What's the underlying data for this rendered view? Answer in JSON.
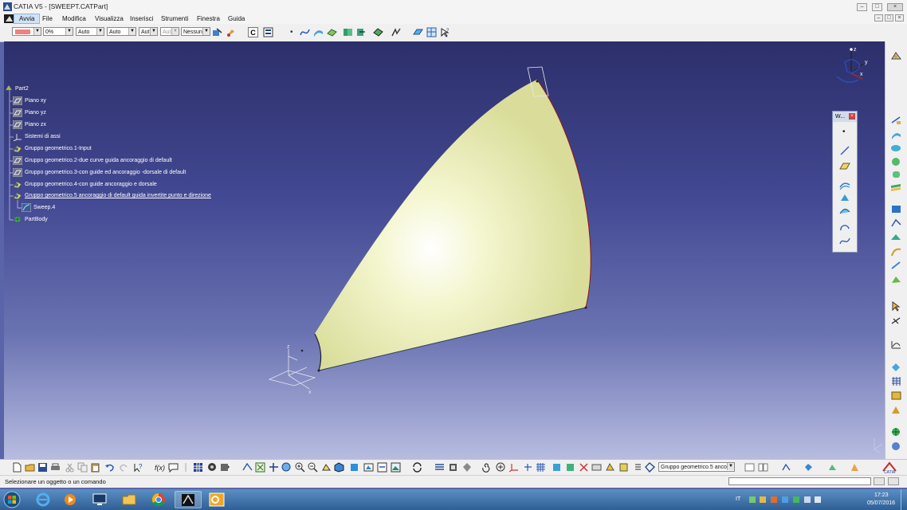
{
  "window": {
    "title": "CATIA V5 - [SWEEPT.CATPart]",
    "controls": [
      "minimize-icon",
      "restore-icon",
      "close-icon"
    ],
    "doc_controls": [
      "minimize-icon",
      "restore-icon",
      "close-icon"
    ]
  },
  "menu": {
    "items": [
      "Avvia",
      "File",
      "Modifica",
      "Visualizza",
      "Inserisci",
      "Strumenti",
      "Finestra",
      "Guida"
    ],
    "active": "Avvia"
  },
  "properties_toolbar": {
    "color": "#f08080",
    "transparency": "0%",
    "line_thickness": "Auto",
    "line_type": "Auto",
    "point_symbol": "Aut",
    "rendering_style": "Aut",
    "layer": "Nessun",
    "c_button": "C"
  },
  "tree": {
    "items": [
      {
        "label": "Part2",
        "icon": "part-icon",
        "level": 0
      },
      {
        "label": "Piano xy",
        "icon": "plane-icon",
        "level": 1
      },
      {
        "label": "Piano yz",
        "icon": "plane-icon",
        "level": 1
      },
      {
        "label": "Piano zx",
        "icon": "plane-icon",
        "level": 1
      },
      {
        "label": "Sistemi di assi",
        "icon": "axis-system-icon",
        "level": 1
      },
      {
        "label": "Gruppo geometrico.1-Input",
        "icon": "geometrical-set-icon",
        "level": 1
      },
      {
        "label": "Gruppo geometrico.2-due curve guida  ancoraggio di default",
        "icon": "geometrical-set-icon",
        "level": 1
      },
      {
        "label": "Gruppo geometrico.3-con guide ed ancoraggio -dorsale di default",
        "icon": "geometrical-set-icon",
        "level": 1
      },
      {
        "label": "Gruppo geometrico.4-con guide ancoraggio e dorsale",
        "icon": "geometrical-set-icon",
        "level": 1
      },
      {
        "label": "Gruppo geometrico.5  ancoraggio di default guida invertite punto e direzione",
        "icon": "geometrical-set-icon",
        "level": 1,
        "selected": true
      },
      {
        "label": "Sweep.4",
        "icon": "sweep-icon",
        "level": 2
      },
      {
        "label": "PartBody",
        "icon": "partbody-icon",
        "level": 1
      }
    ]
  },
  "compass": {
    "labels": [
      "z",
      "y",
      "x"
    ]
  },
  "axis_labels": {
    "z": "z",
    "y": "y",
    "x": "x"
  },
  "floating_toolbar": {
    "title": "W..."
  },
  "bottom_toolbar": {
    "current_set": "Gruppo geometrico.5  anco"
  },
  "status": {
    "message": "Selezionare un oggetto o un comando",
    "command_input": ""
  },
  "taskbar": {
    "apps": [
      "windows-start-icon",
      "internet-explorer-icon",
      "media-player-icon",
      "desktop-icon",
      "file-explorer-icon",
      "chrome-icon",
      "catia-icon",
      "outlook-icon"
    ],
    "active_app": "catia-icon",
    "language": "IT",
    "time": "17:23",
    "date": "05/07/2016"
  },
  "colors": {
    "surface": "#e7eab0",
    "surface_edge": "#8b1a1a",
    "viewport_top": "#2c2f6a",
    "viewport_bottom": "#b7bce0",
    "tree_text": "#ffffff"
  }
}
